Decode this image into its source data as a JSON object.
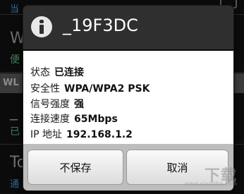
{
  "background": {
    "top_partial_label": "当",
    "row1_title": "W",
    "row1_sub": "便",
    "section_header": "WL",
    "row2_title": "_",
    "row2_sub": "已",
    "row3_title": "To",
    "row3_sub": "通"
  },
  "dialog": {
    "icon": "info-icon",
    "title": "_19F3DC",
    "rows": [
      {
        "label": "状态",
        "value": "已连接"
      },
      {
        "label": "安全性",
        "value": "WPA/WPA2 PSK"
      },
      {
        "label": "信号强度",
        "value": "强"
      },
      {
        "label": "连接速度",
        "value": "65Mbps"
      },
      {
        "label": "IP 地址",
        "value": "192.168.1.2"
      }
    ],
    "buttons": {
      "forget": "不保存",
      "cancel": "取消"
    }
  },
  "watermark": {
    "brand": "下载",
    "url": "www.xiazaiba.com"
  },
  "colors": {
    "dialog_header": "#2f2f2f",
    "dialog_body": "#ffffff",
    "dialog_footer": "#bdbdbd",
    "background": "#0b0b0b"
  }
}
